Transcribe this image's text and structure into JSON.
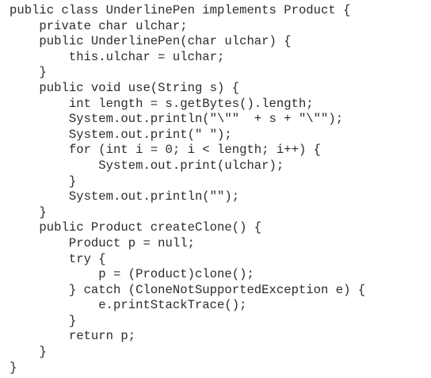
{
  "code": {
    "lines": [
      "public class UnderlinePen implements Product {",
      "    private char ulchar;",
      "    public UnderlinePen(char ulchar) {",
      "        this.ulchar = ulchar;",
      "    }",
      "    public void use(String s) {",
      "        int length = s.getBytes().length;",
      "        System.out.println(\"\\\"\"  + s + \"\\\"\");",
      "        System.out.print(\" \");",
      "        for (int i = 0; i < length; i++) {",
      "            System.out.print(ulchar);",
      "        }",
      "        System.out.println(\"\");",
      "    }",
      "    public Product createClone() {",
      "        Product p = null;",
      "        try {",
      "            p = (Product)clone();",
      "        } catch (CloneNotSupportedException e) {",
      "            e.printStackTrace();",
      "        }",
      "        return p;",
      "    }",
      "}"
    ]
  }
}
